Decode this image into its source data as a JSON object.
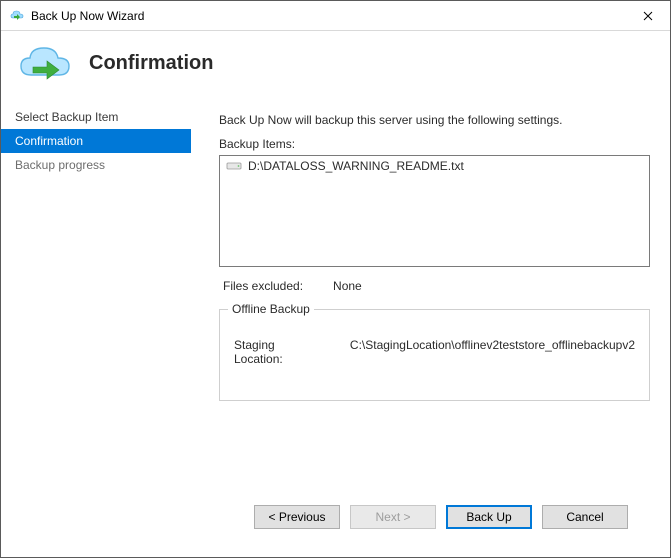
{
  "window": {
    "title": "Back Up Now Wizard"
  },
  "header": {
    "heading": "Confirmation"
  },
  "sidebar": {
    "items": [
      {
        "label": "Select Backup Item"
      },
      {
        "label": "Confirmation"
      },
      {
        "label": "Backup progress"
      }
    ]
  },
  "content": {
    "intro": "Back Up Now will backup this server using the following settings.",
    "backup_items_label": "Backup Items:",
    "backup_items": [
      "D:\\DATALOSS_WARNING_README.txt"
    ],
    "files_excluded_label": "Files excluded:",
    "files_excluded_value": "None",
    "offline_backup": {
      "legend": "Offline Backup",
      "staging_label": "Staging Location:",
      "staging_value": "C:\\StagingLocation\\offlinev2teststore_offlinebackupv2"
    }
  },
  "footer": {
    "previous": "< Previous",
    "next": "Next >",
    "backup": "Back Up",
    "cancel": "Cancel"
  }
}
